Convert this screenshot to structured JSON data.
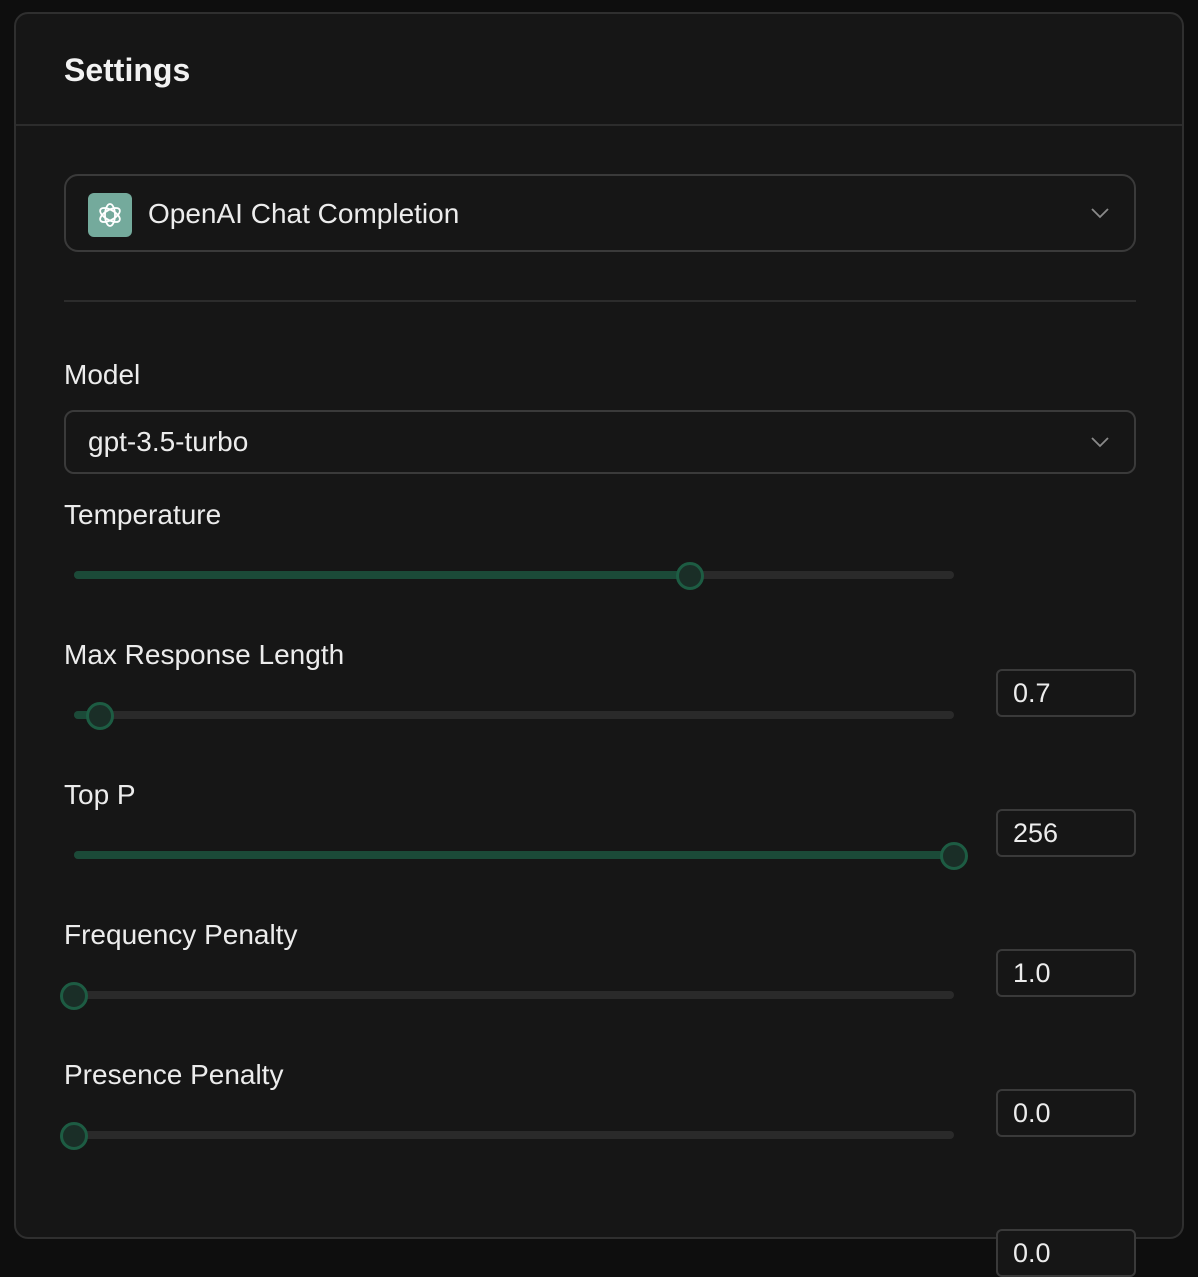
{
  "panel": {
    "title": "Settings"
  },
  "provider": {
    "label": "OpenAI Chat Completion",
    "icon": "openai-logo-icon",
    "accent_color": "#74aa9c"
  },
  "model": {
    "label": "Model",
    "value": "gpt-3.5-turbo"
  },
  "sliders": [
    {
      "label": "Temperature",
      "value": "0.7",
      "fraction": 0.7
    },
    {
      "label": "Max Response Length",
      "value": "256",
      "fraction": 0.03
    },
    {
      "label": "Top P",
      "value": "1.0",
      "fraction": 1.0
    },
    {
      "label": "Frequency Penalty",
      "value": "0.0",
      "fraction": 0.0
    },
    {
      "label": "Presence Penalty",
      "value": "0.0",
      "fraction": 0.0
    }
  ],
  "colors": {
    "background": "#161616",
    "slider_fill": "#1b4a38",
    "slider_thumb_border": "#1d5c43"
  }
}
